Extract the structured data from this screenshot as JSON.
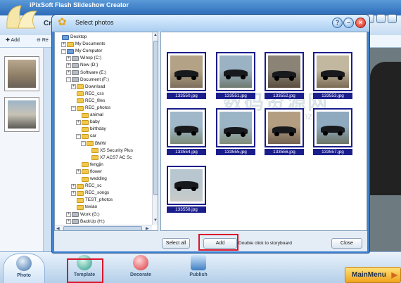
{
  "app": {
    "title": "iPixSoft Flash Slideshow Creator",
    "subtitle": "Cr",
    "toolbar": {
      "add_label": "Add",
      "re_label": "Re"
    }
  },
  "bottom_nav": [
    {
      "label": "Photo",
      "icon": "photo-icon"
    },
    {
      "label": "Template",
      "icon": "template-globe-icon"
    },
    {
      "label": "Decorate",
      "icon": "decorate-heart-icon"
    },
    {
      "label": "Publish",
      "icon": "publish-icon"
    }
  ],
  "main_menu_label": "MainMenu",
  "dialog": {
    "title": "Select photos",
    "controls": {
      "help": "?",
      "minimize": "−",
      "close": "×"
    },
    "tree": [
      {
        "label": "Desktop",
        "icon": "desktop-icon",
        "exp": ""
      },
      {
        "label": "My Documents",
        "icon": "folder-icon",
        "exp": "+"
      },
      {
        "label": "My Computer",
        "icon": "computer-icon",
        "exp": "−"
      },
      {
        "label": "Winxp (C:)",
        "icon": "drive-icon",
        "exp": "+"
      },
      {
        "label": "New (D:)",
        "icon": "drive-icon",
        "exp": "+"
      },
      {
        "label": "Software (E:)",
        "icon": "drive-icon",
        "exp": "+"
      },
      {
        "label": "Document (F:)",
        "icon": "drive-icon",
        "exp": "−"
      },
      {
        "label": "Download",
        "icon": "folder-icon",
        "exp": "+"
      },
      {
        "label": "REC_css",
        "icon": "folder-icon",
        "exp": ""
      },
      {
        "label": "REC_files",
        "icon": "folder-icon",
        "exp": ""
      },
      {
        "label": "REC_photos",
        "icon": "folder-icon",
        "exp": "−"
      },
      {
        "label": "animal",
        "icon": "folder-icon",
        "exp": ""
      },
      {
        "label": "baby",
        "icon": "folder-icon",
        "exp": "+"
      },
      {
        "label": "birthday",
        "icon": "folder-icon",
        "exp": ""
      },
      {
        "label": "car",
        "icon": "folder-icon",
        "exp": "−"
      },
      {
        "label": "BMW",
        "icon": "folder-icon",
        "exp": "−"
      },
      {
        "label": "X5 Security Plus",
        "icon": "folder-icon",
        "exp": ""
      },
      {
        "label": "X7 ACS7 AC Sc",
        "icon": "folder-icon",
        "exp": ""
      },
      {
        "label": "fengjin",
        "icon": "folder-icon",
        "exp": ""
      },
      {
        "label": "flower",
        "icon": "folder-icon",
        "exp": "+"
      },
      {
        "label": "wedding",
        "icon": "folder-icon",
        "exp": ""
      },
      {
        "label": "REC_sc",
        "icon": "folder-icon",
        "exp": "+"
      },
      {
        "label": "REC_songs",
        "icon": "folder-icon",
        "exp": "+"
      },
      {
        "label": "TEST_photos",
        "icon": "folder-icon",
        "exp": ""
      },
      {
        "label": "texiao",
        "icon": "folder-icon",
        "exp": ""
      },
      {
        "label": "Work (G:)",
        "icon": "drive-icon",
        "exp": "+"
      },
      {
        "label": "BackUp (H:)",
        "icon": "drive-icon",
        "exp": "+"
      }
    ],
    "photos": [
      {
        "name": "133550.jpg"
      },
      {
        "name": "133551.jpg"
      },
      {
        "name": "133552.jpg"
      },
      {
        "name": "133553.jpg"
      },
      {
        "name": "133554.jpg"
      },
      {
        "name": "133555.jpg"
      },
      {
        "name": "133556.jpg"
      },
      {
        "name": "133557.jpg"
      },
      {
        "name": "133558.jpg"
      }
    ],
    "footer": {
      "select_all": "Select all",
      "add": "Add",
      "hint": "Double click to storyboard",
      "close": "Close"
    }
  },
  "watermark": {
    "text": "数码资源网",
    "url": "www.smzy.com"
  },
  "colors": {
    "dialog_border": "#3f82d2",
    "selection": "#1a1d8c",
    "highlight": "#d8152b"
  }
}
